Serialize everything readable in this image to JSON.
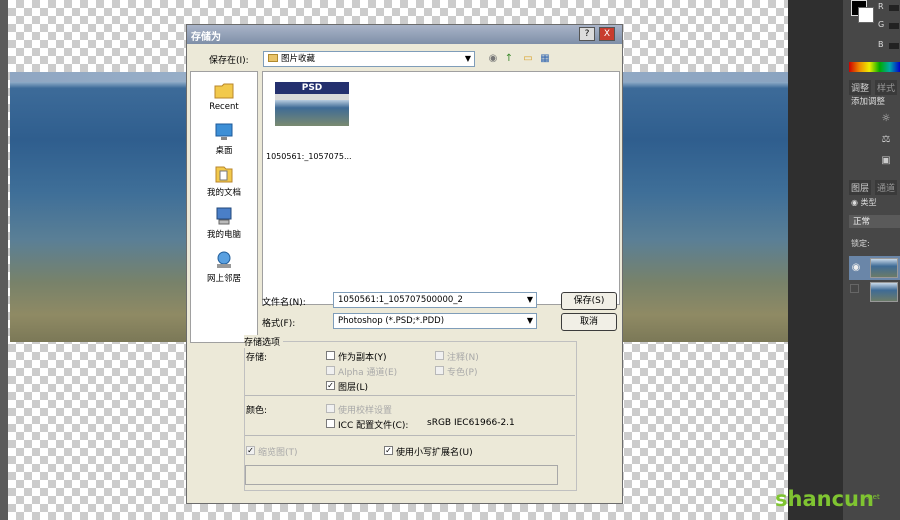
{
  "dialog": {
    "title": "存储为",
    "help_btn": "?",
    "close_btn": "X",
    "save_in_label": "保存在(I):",
    "save_in_value": "图片收藏",
    "places": [
      {
        "label": "Recent",
        "icon": "recent-folder-icon"
      },
      {
        "label": "桌面",
        "icon": "desktop-icon"
      },
      {
        "label": "我的文档",
        "icon": "my-documents-icon"
      },
      {
        "label": "我的电脑",
        "icon": "my-computer-icon"
      },
      {
        "label": "网上邻居",
        "icon": "network-icon"
      }
    ],
    "file_item": {
      "badge": "PSD",
      "name": "1050561:_1057075..."
    },
    "filename_label": "文件名(N):",
    "filename_value": "1050561:1_105707500000_2",
    "format_label": "格式(F):",
    "format_value": "Photoshop (*.PSD;*.PDD)",
    "save_btn": "保存(S)",
    "cancel_btn": "取消",
    "options": {
      "group_title": "存储选项",
      "store_label": "存储:",
      "as_copy": "作为副本(Y)",
      "notes": "注释(N)",
      "alpha": "Alpha 通道(E)",
      "spot": "专色(P)",
      "layers": "图层(L)",
      "color_label": "颜色:",
      "proof": "使用校样设置",
      "icc": "ICC 配置文件(C):",
      "icc_value": "sRGB IEC61966-2.1",
      "thumbnail": "缩览图(T)",
      "lowercase_ext": "使用小写扩展名(U)"
    }
  },
  "right_panel": {
    "channels": [
      "R",
      "G",
      "B"
    ],
    "tab_adjust": "调整",
    "tab_style": "样式",
    "add_adjust": "添加调整",
    "tab_layers": "图层",
    "tab_channels": "通道",
    "kind_filter": "类型",
    "blend_mode": "正常",
    "lock_label": "锁定:"
  },
  "watermark": {
    "text": "shancun",
    "sub": ".net"
  }
}
